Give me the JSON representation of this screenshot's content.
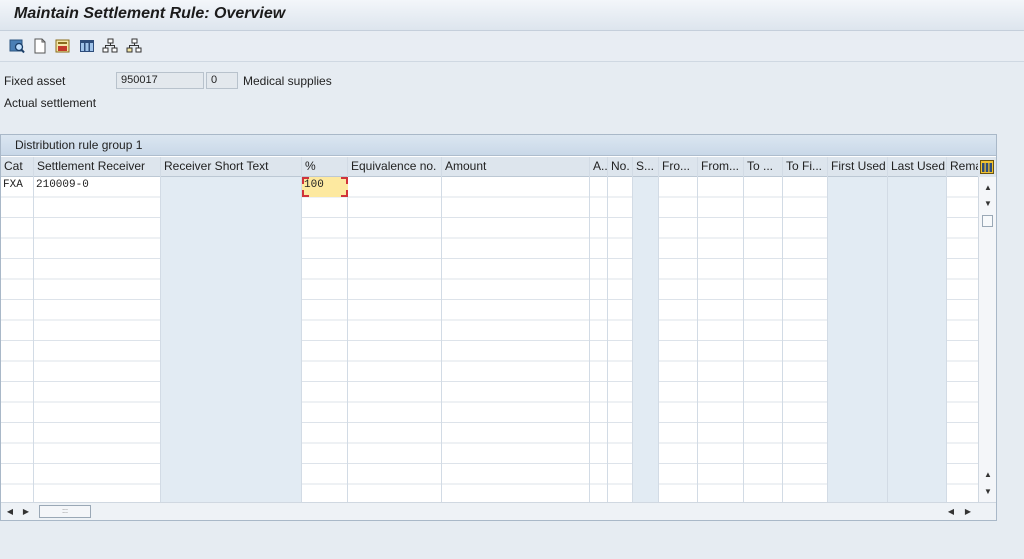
{
  "window": {
    "title": "Maintain Settlement Rule: Overview"
  },
  "toolbar": {
    "buttons": [
      {
        "icon": "display-change-icon"
      },
      {
        "icon": "new-document-icon"
      },
      {
        "icon": "save-layout-icon"
      },
      {
        "icon": "table-icon"
      },
      {
        "icon": "hierarchy-icon"
      },
      {
        "icon": "structure-icon"
      }
    ]
  },
  "header": {
    "fixed_asset_label": "Fixed asset",
    "asset_number": "950017",
    "sub_number": "0",
    "asset_description": "Medical supplies",
    "settlement_type": "Actual settlement"
  },
  "table": {
    "group_title": "Distribution rule group 1",
    "columns": [
      "Cat",
      "Settlement Receiver",
      "Receiver Short Text",
      "%",
      "Equivalence no.",
      "Amount",
      "A..",
      "No.",
      "S...",
      "Fro...",
      "From...",
      "To ...",
      "To Fi...",
      "First Used",
      "Last Used",
      "Rema"
    ],
    "rows": [
      {
        "cat": "FXA",
        "receiver": "210009-0",
        "short_text": "",
        "percent": "100"
      }
    ]
  }
}
